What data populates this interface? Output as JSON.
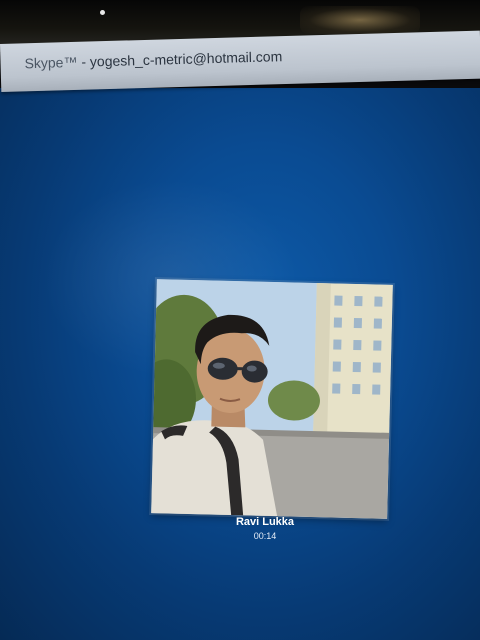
{
  "window": {
    "app_name": "Skype™",
    "separator": " - ",
    "account": "yogesh_c-metric@hotmail.com"
  },
  "call": {
    "caller_name": "Ravi Lukka",
    "duration": "00:14"
  },
  "colors": {
    "call_background": "#0a4b92",
    "titlebar": "#c5ccd5",
    "text_light": "#ffffff"
  },
  "icons": {
    "avatar": "caller-avatar-photo"
  }
}
